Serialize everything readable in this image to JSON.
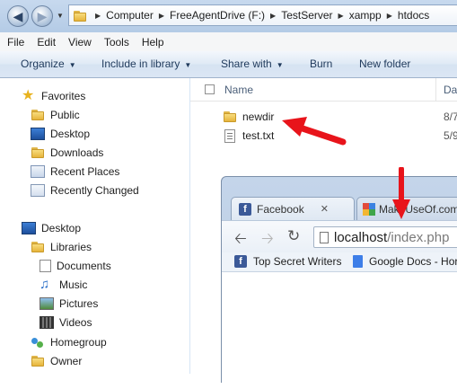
{
  "address": {
    "crumbs": [
      "Computer",
      "FreeAgentDrive (F:)",
      "TestServer",
      "xampp",
      "htdocs"
    ]
  },
  "menu": [
    "File",
    "Edit",
    "View",
    "Tools",
    "Help"
  ],
  "commands": {
    "organize": "Organize",
    "include": "Include in library",
    "share": "Share with",
    "burn": "Burn",
    "new_folder": "New folder"
  },
  "nav": {
    "favorites": "Favorites",
    "public": "Public",
    "desktop_fav": "Desktop",
    "downloads": "Downloads",
    "recent_places": "Recent Places",
    "recently_changed": "Recently Changed",
    "desktop": "Desktop",
    "libraries": "Libraries",
    "documents": "Documents",
    "music": "Music",
    "pictures": "Pictures",
    "videos": "Videos",
    "homegroup": "Homegroup",
    "owner": "Owner"
  },
  "files": {
    "col_name": "Name",
    "col_date": "Dat",
    "rows": [
      {
        "name": "newdir",
        "date": "8/7"
      },
      {
        "name": "test.txt",
        "date": "5/9"
      }
    ]
  },
  "browser": {
    "tab1": "Facebook",
    "tab2": "MakeUseOf.com",
    "url_host": "localhost",
    "url_path": "/index.php",
    "bookmark1": "Top Secret Writers",
    "bookmark2": "Google Docs - Hor"
  },
  "colors": {
    "arrow": "#e8141b",
    "accent": "#1e395b"
  }
}
